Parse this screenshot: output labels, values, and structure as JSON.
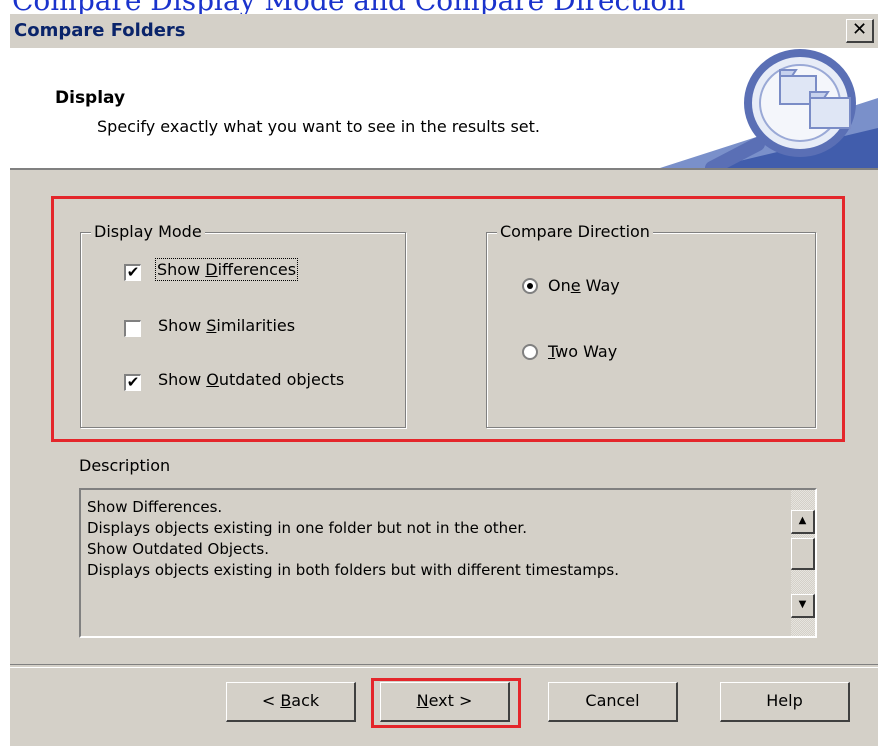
{
  "top_strip_text": "Compare Display Mode and Compare Direction",
  "window": {
    "title": "Compare Folders",
    "close_glyph": "✕"
  },
  "header": {
    "title": "Display",
    "subtitle": "Specify exactly what you want to see in the results set.",
    "art_icon": "folder-magnifier-icon"
  },
  "display_mode": {
    "legend": "Display Mode",
    "options": [
      {
        "pre": "Show ",
        "mnemonic": "D",
        "post": "ifferences",
        "checked": true
      },
      {
        "pre": "Show ",
        "mnemonic": "S",
        "post": "imilarities",
        "checked": false
      },
      {
        "pre": "Show ",
        "mnemonic": "O",
        "post": "utdated objects",
        "checked": true
      }
    ]
  },
  "compare_direction": {
    "legend": "Compare Direction",
    "options": [
      {
        "pre": "On",
        "mnemonic": "e",
        "post": " Way",
        "selected": true
      },
      {
        "pre": "",
        "mnemonic": "T",
        "post": "wo Way",
        "selected": false
      }
    ]
  },
  "description": {
    "label": "Description",
    "lines": [
      "Show Differences.",
      "Displays objects existing in one folder but not in the other.",
      "Show Outdated Objects.",
      "Displays objects existing in both folders but with different timestamps."
    ]
  },
  "buttons": {
    "back": {
      "pre": "< ",
      "mnemonic": "B",
      "post": "ack"
    },
    "next": {
      "pre": "",
      "mnemonic": "N",
      "post": "ext >"
    },
    "cancel": {
      "label": "Cancel"
    },
    "help": {
      "label": "Help"
    }
  },
  "colors": {
    "dialog_bg": "#d4d0c8",
    "title_text": "#0a246a",
    "highlight_red": "#e4262b",
    "top_strip_text": "#1a33cc"
  }
}
